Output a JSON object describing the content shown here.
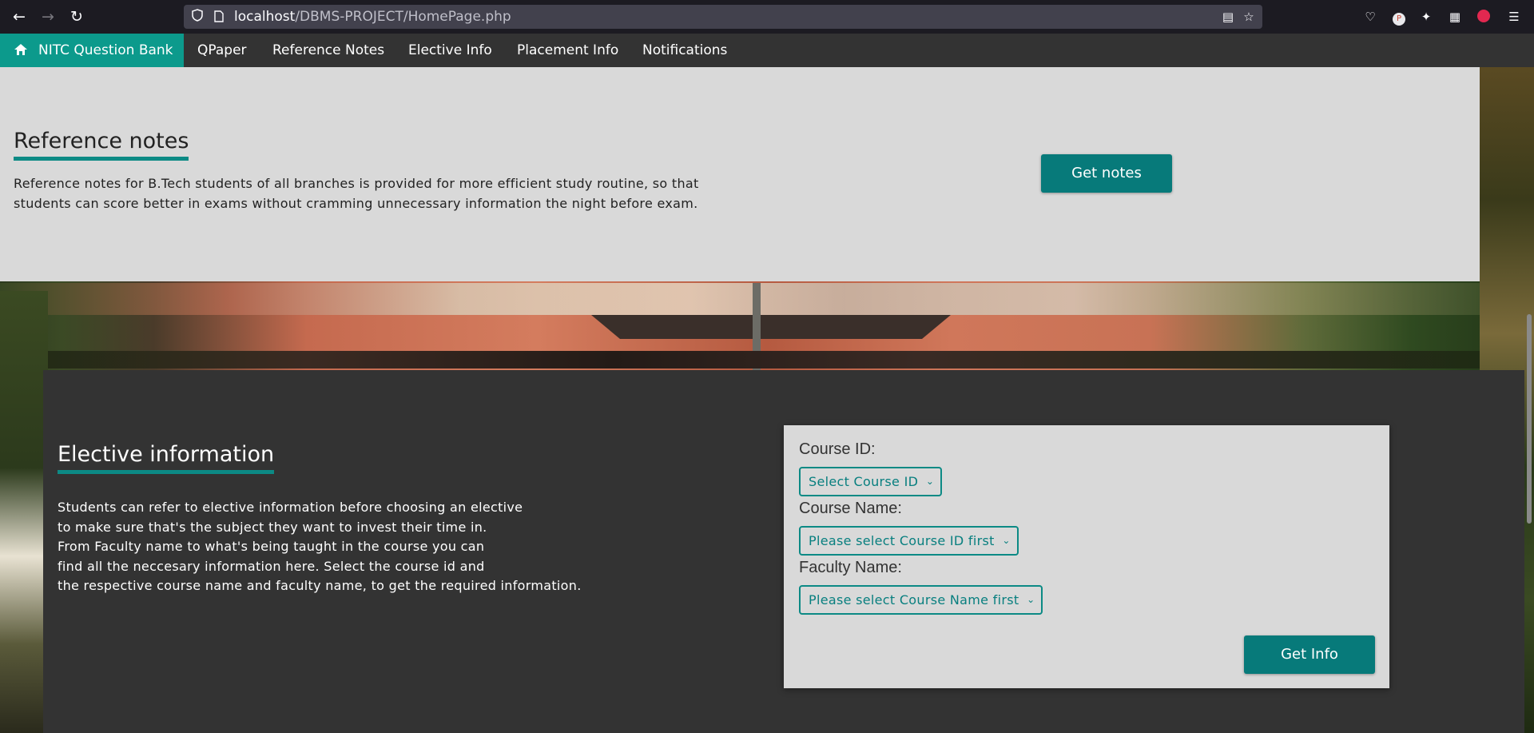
{
  "browser": {
    "url_host": "localhost",
    "url_path": "/DBMS-PROJECT/HomePage.php"
  },
  "navbar": {
    "brand": "NITC Question Bank",
    "items": [
      {
        "label": "QPaper"
      },
      {
        "label": "Reference Notes"
      },
      {
        "label": "Elective Info"
      },
      {
        "label": "Placement Info"
      },
      {
        "label": "Notifications"
      }
    ]
  },
  "reference": {
    "title": "Reference notes",
    "description": "Reference notes for B.Tech students of all branches is provided for more efficient study routine, so that students can score better in exams without cramming unnecessary information the night before exam.",
    "button": "Get notes"
  },
  "elective": {
    "title": "Elective information",
    "description_lines": [
      "Students can refer to elective information before choosing an elective",
      "to make sure that's the subject they want to invest their time in.",
      "From Faculty name to what's being taught in the course you can",
      "find all the neccesary information here. Select the course id and",
      "the respective course name and faculty name, to get the required information."
    ],
    "form": {
      "course_id_label": "Course ID:",
      "course_id_value": "Select Course ID",
      "course_name_label": "Course Name:",
      "course_name_value": "Please select Course ID first",
      "faculty_label": "Faculty Name:",
      "faculty_value": "Please select Course Name first",
      "button": "Get Info"
    }
  },
  "colors": {
    "accent": "#0c8a85",
    "navbar_bg": "#333333",
    "panel_light": "#d9d9d9"
  }
}
